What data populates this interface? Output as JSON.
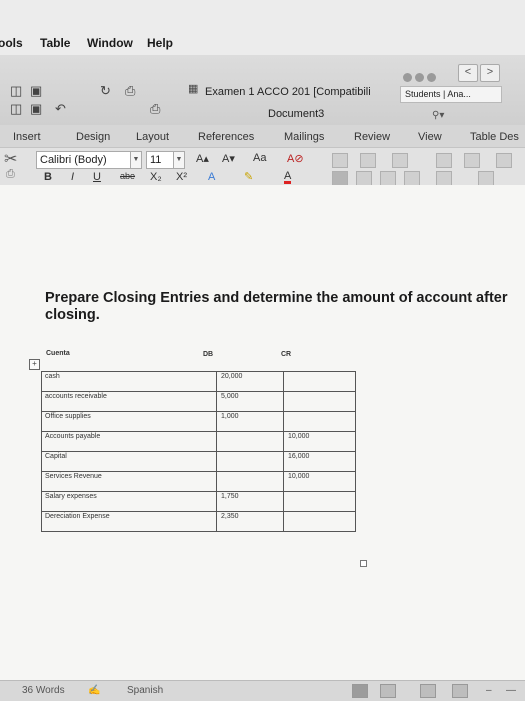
{
  "menubar": {
    "items": [
      "ools",
      "Table",
      "Window",
      "Help"
    ]
  },
  "titlebar": {
    "doc_title": "Examen 1 ACCO 201 [Compatibili",
    "doc_name": "Document3",
    "share_label": "Students | Ana...",
    "nav_prev": "<",
    "nav_next": ">"
  },
  "tabs": [
    "Insert",
    "Design",
    "Layout",
    "References",
    "Mailings",
    "Review",
    "View",
    "Table Des"
  ],
  "ribbon": {
    "font_name": "Calibri (Body)",
    "font_size": "11",
    "grow_font": "A▴",
    "shrink_font": "A▾",
    "change_case": "Aa",
    "bold": "B",
    "italic": "I",
    "underline": "U",
    "strikethrough": "abe",
    "subscript": "X₂",
    "superscript": "X²",
    "text_effects": "A",
    "highlight": "✎",
    "font_color": "A"
  },
  "document": {
    "heading": "Prepare Closing Entries and determine the amount of account after closing.",
    "columns": {
      "account": "Cuenta",
      "debit": "DB",
      "credit": "CR"
    },
    "rows": [
      {
        "account": "cash",
        "db": "20,000",
        "cr": ""
      },
      {
        "account": "accounts receivable",
        "db": "5,000",
        "cr": ""
      },
      {
        "account": "Office supplies",
        "db": "1,000",
        "cr": ""
      },
      {
        "account": "Accounts payable",
        "db": "",
        "cr": "10,000"
      },
      {
        "account": "Capital",
        "db": "",
        "cr": "16,000"
      },
      {
        "account": "Services Revenue",
        "db": "",
        "cr": "10,000"
      },
      {
        "account": "Salary expenses",
        "db": "1,750",
        "cr": ""
      },
      {
        "account": "Dereciation Expense",
        "db": "2,350",
        "cr": ""
      }
    ]
  },
  "statusbar": {
    "word_count": "36 Words",
    "language": "Spanish"
  }
}
